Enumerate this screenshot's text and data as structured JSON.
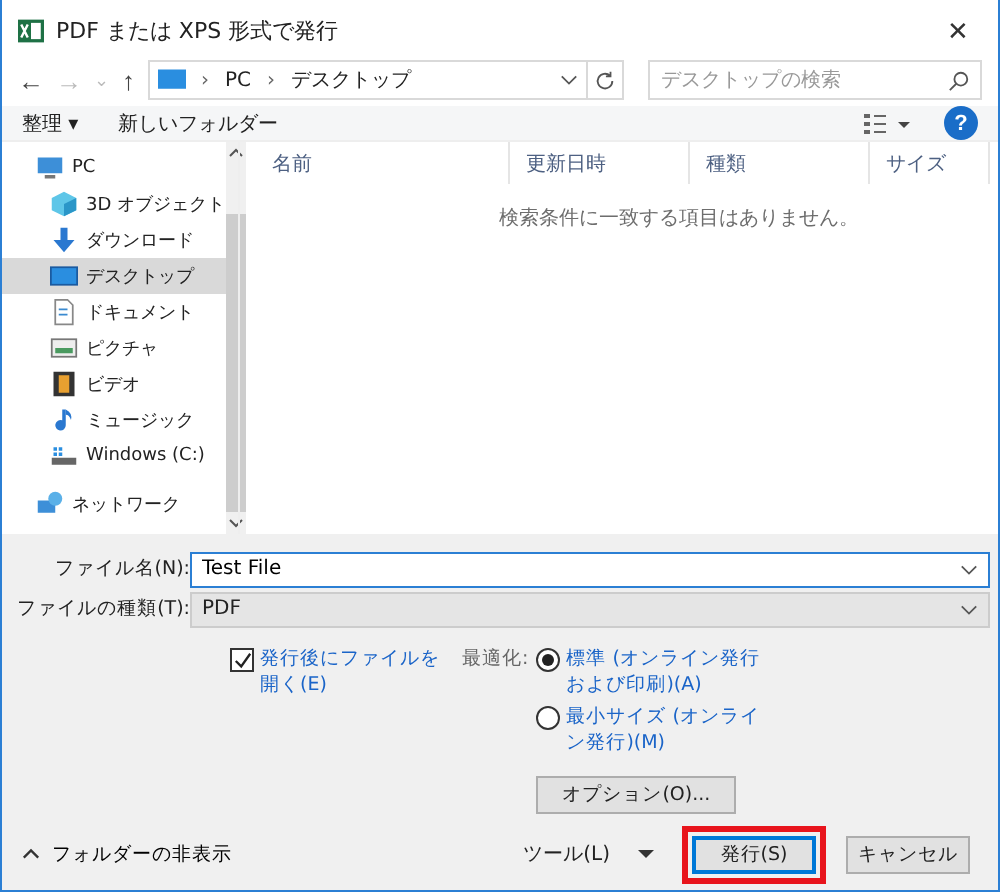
{
  "window": {
    "title": "PDF または XPS 形式で発行",
    "close": "✕"
  },
  "nav": {
    "back": "←",
    "forward": "→",
    "recent": "⌄",
    "up": "↑",
    "path": [
      {
        "label": "PC"
      },
      {
        "label": "デスクトップ"
      }
    ],
    "separator": "›",
    "search": {
      "placeholder": "デスクトップの検索"
    }
  },
  "toolbar": {
    "organize": "整理 ▾",
    "new_folder": "新しいフォルダー",
    "help": "?"
  },
  "sidebar": {
    "items": [
      {
        "label": "PC",
        "kind": "pc",
        "selected": false,
        "children": [
          {
            "label": "3D オブジェクト",
            "kind": "cube",
            "selected": false
          },
          {
            "label": "ダウンロード",
            "kind": "download",
            "selected": false
          },
          {
            "label": "デスクトップ",
            "kind": "desktop",
            "selected": true
          },
          {
            "label": "ドキュメント",
            "kind": "document",
            "selected": false
          },
          {
            "label": "ピクチャ",
            "kind": "picture",
            "selected": false
          },
          {
            "label": "ビデオ",
            "kind": "video",
            "selected": false
          },
          {
            "label": "ミュージック",
            "kind": "music",
            "selected": false
          },
          {
            "label": "Windows (C:)",
            "kind": "drive",
            "selected": false
          }
        ]
      },
      {
        "label": "ネットワーク",
        "kind": "network",
        "selected": false
      }
    ]
  },
  "table": {
    "columns": [
      "名前",
      "更新日時",
      "種類",
      "サイズ"
    ],
    "empty_message": "検索条件に一致する項目はありません。"
  },
  "form": {
    "file_name": {
      "label": "ファイル名(N):",
      "value": "Test File"
    },
    "file_type": {
      "label": "ファイルの種類(T):",
      "value": "PDF"
    },
    "open_after": {
      "label": "発行後にファイルを開く(E)",
      "checked": true
    },
    "optimize": {
      "label": "最適化:",
      "options": [
        {
          "label": "標準 (オンライン発行および印刷)(A)",
          "selected": true
        },
        {
          "label": "最小サイズ (オンライン発行)(M)",
          "selected": false
        }
      ]
    },
    "options_button": "オプション(O)..."
  },
  "footer": {
    "hide_folders": "フォルダーの非表示",
    "tools": "ツール(L)",
    "buttons": [
      {
        "label": "発行(S)",
        "default": true,
        "highlighted": true
      },
      {
        "label": "キャンセル",
        "default": false,
        "highlighted": false
      }
    ]
  }
}
